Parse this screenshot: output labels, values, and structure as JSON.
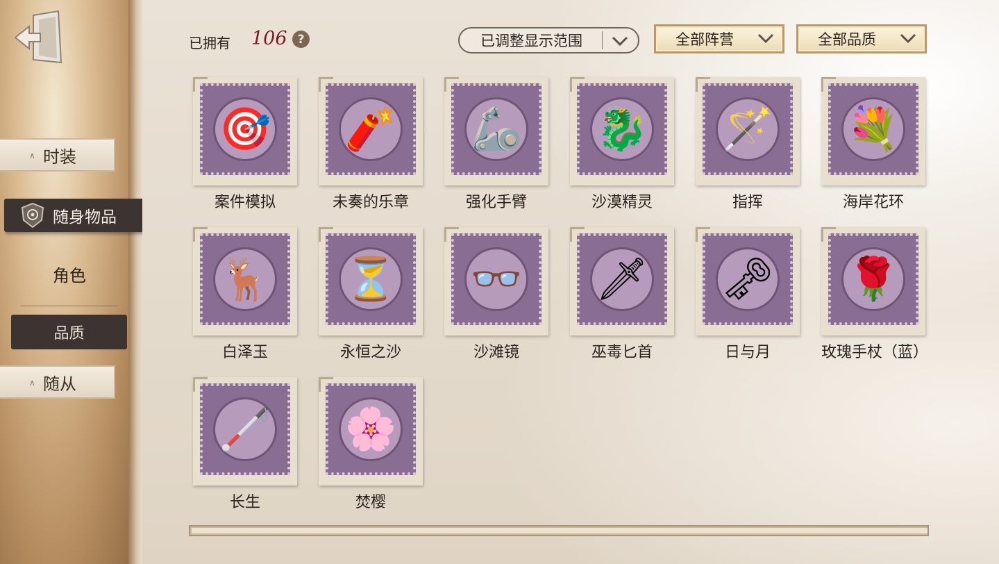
{
  "header": {
    "owned_label": "已拥有",
    "owned_count": "106",
    "help_icon": "?",
    "dropdowns": {
      "range": "已调整显示范围",
      "faction": "全部阵营",
      "quality": "全部品质"
    }
  },
  "sidebar": {
    "tabs": [
      {
        "label": "时装"
      },
      {
        "label": "随身物品"
      },
      {
        "label": "角色"
      }
    ],
    "subtabs": [
      {
        "label": "品质"
      },
      {
        "label": "随从"
      }
    ]
  },
  "items": [
    {
      "name": "案件模拟",
      "icon": "🎯"
    },
    {
      "name": "未奏的乐章",
      "icon": "🧨"
    },
    {
      "name": "强化手臂",
      "icon": "🦾"
    },
    {
      "name": "沙漠精灵",
      "icon": "🐉"
    },
    {
      "name": "指挥",
      "icon": "🪄"
    },
    {
      "name": "海岸花环",
      "icon": "💐"
    },
    {
      "name": "白泽玉",
      "icon": "🦌"
    },
    {
      "name": "永恒之沙",
      "icon": "⏳"
    },
    {
      "name": "沙滩镜",
      "icon": "👓"
    },
    {
      "name": "巫毒匕首",
      "icon": "🗡"
    },
    {
      "name": "日与月",
      "icon": "🗝"
    },
    {
      "name": "玫瑰手杖（蓝）",
      "icon": "🌹"
    },
    {
      "name": "长生",
      "icon": "🦯"
    },
    {
      "name": "焚樱",
      "icon": "🌸"
    }
  ],
  "colors": {
    "accent_dark": "#3b3430",
    "count_red": "#7a1d22",
    "stamp_purple": "#8a6d92"
  }
}
